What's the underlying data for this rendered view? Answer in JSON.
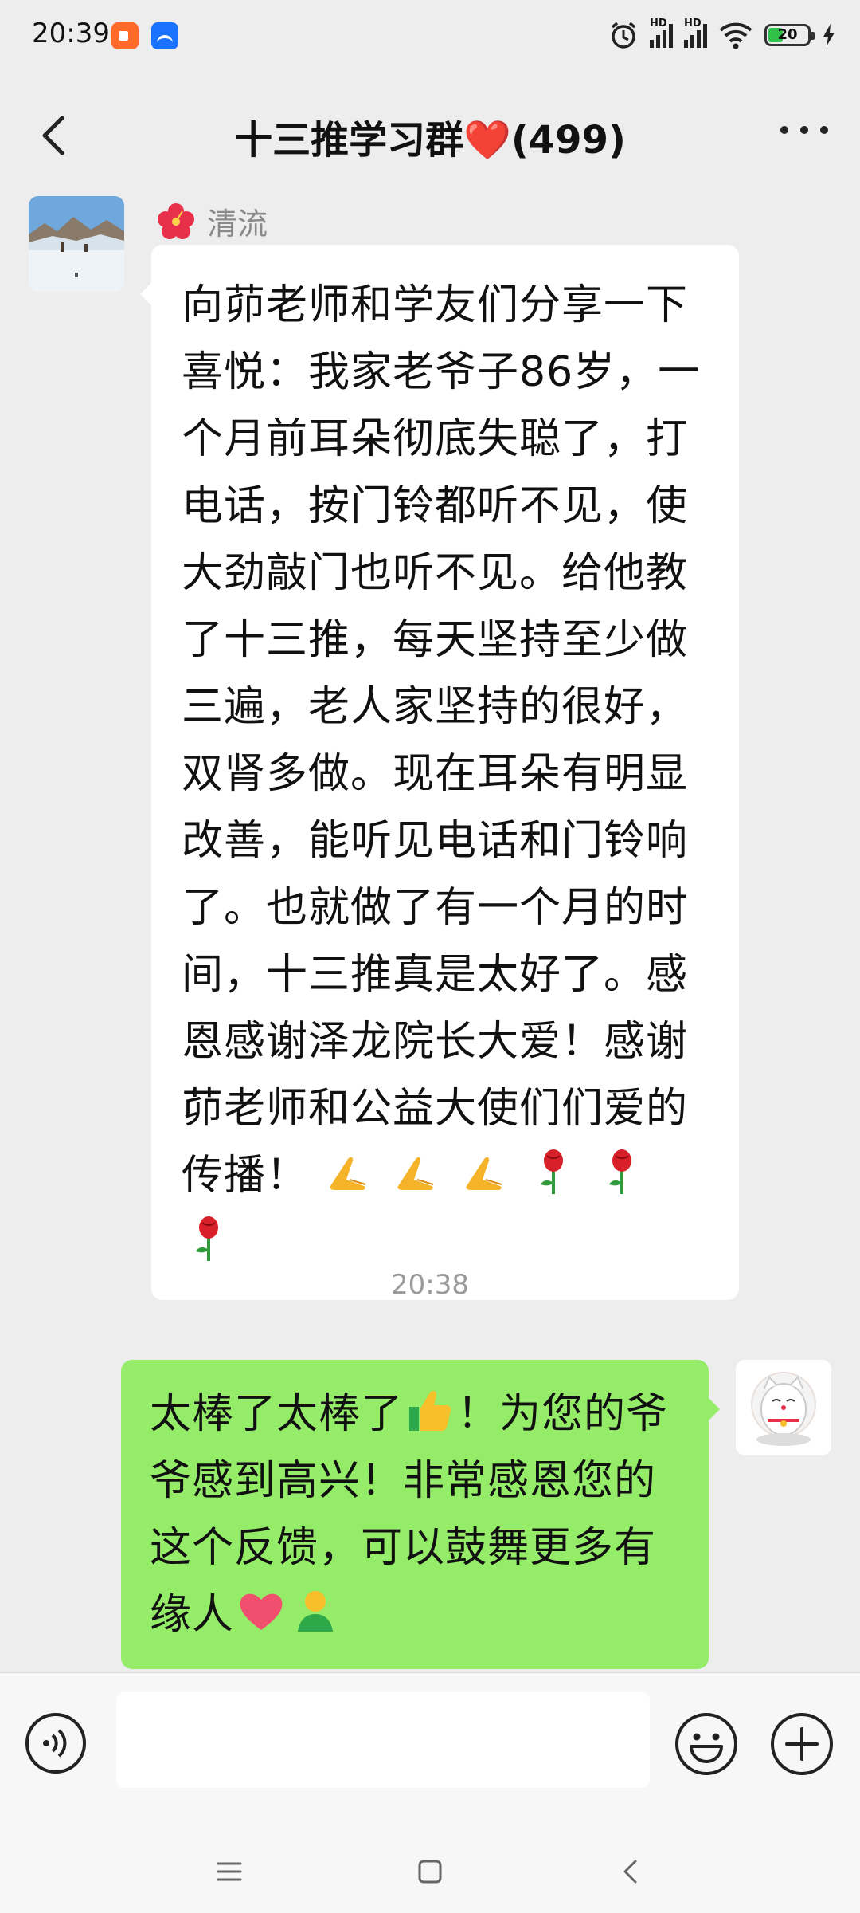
{
  "status_bar": {
    "time": "20:39",
    "signal1_label": "HD",
    "signal2_label": "HD",
    "battery_level": "20"
  },
  "header": {
    "title": "十三推学习群❤️(499)"
  },
  "messages": [
    {
      "direction": "incoming",
      "sender": "清流",
      "text": "向茆老师和学友们分享一下喜悦：我家老爷子86岁，一个月前耳朵彻底失聪了，打电话，按门铃都听不见，使大劲敲门也听不见。给他教了十三推，每天坚持至少做三遍，老人家坚持的很好，双肾多做。现在耳朵有明显改善，能听见电话和门铃响了。也就做了有一个月的时间，十三推真是太好了。感恩感谢泽龙院长大爱！感谢茆老师和公益大使们们爱的传播！",
      "trailing_emojis": [
        "pray",
        "pray",
        "pray",
        "rose",
        "rose",
        "rose"
      ]
    },
    {
      "direction": "timestamp",
      "text": "20:38"
    },
    {
      "direction": "outgoing",
      "text_part1": "太棒了太棒了",
      "text_part2": "！为您的爷爷感到高兴！非常感恩您的这个反馈，可以鼓舞更多有缘人",
      "emojis": [
        "thumbs-up",
        "heart",
        "person"
      ]
    }
  ],
  "input": {
    "value": "",
    "placeholder": ""
  },
  "colors": {
    "background": "#ededed",
    "outgoing_bubble": "#95ec69",
    "incoming_bubble": "#ffffff",
    "battery_fill": "#31c14a"
  }
}
